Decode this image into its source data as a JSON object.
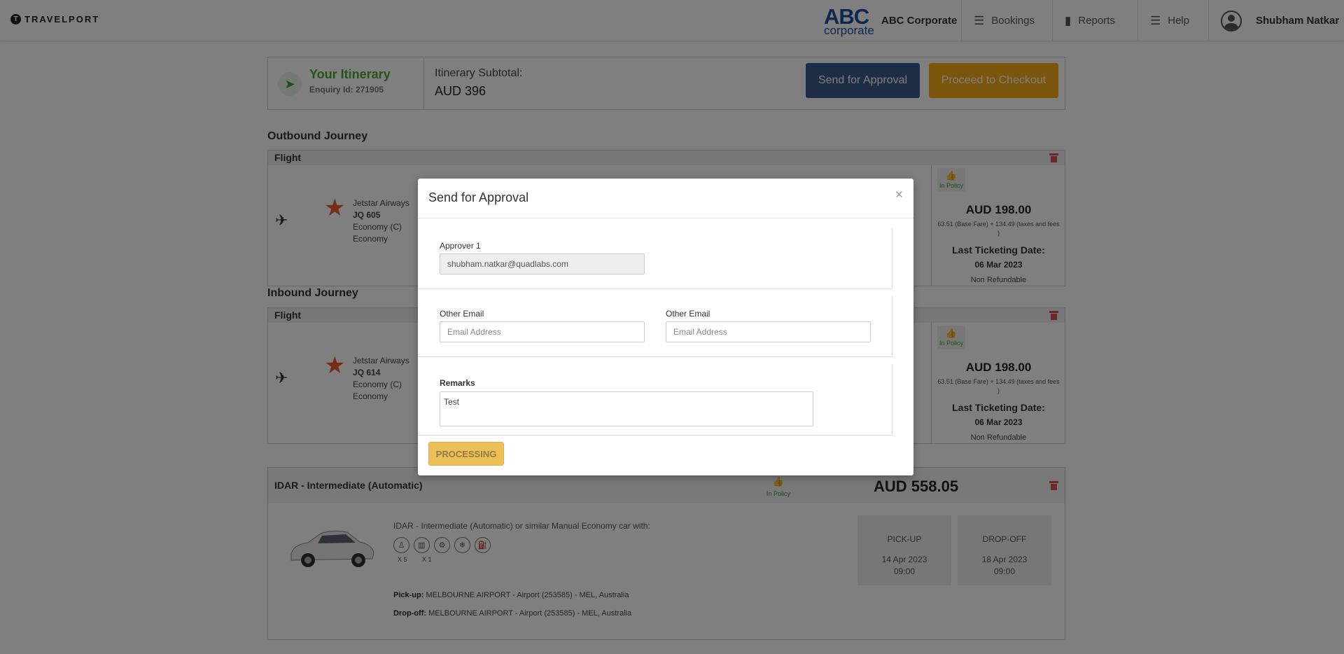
{
  "header": {
    "brand": "TRAVELPORT",
    "corp_logo_main": "ABC",
    "corp_logo_sub": "corporate",
    "company": "ABC Corporate",
    "nav": [
      {
        "label": "Bookings",
        "icon": "list-icon"
      },
      {
        "label": "Reports",
        "icon": "bar-chart-icon"
      },
      {
        "label": "Help",
        "icon": "list-icon"
      }
    ],
    "user_name": "Shubham Natkar"
  },
  "itinerary": {
    "title": "Your Itinerary",
    "enquiry": "Enquiry Id: 271905",
    "subtotal_label": "Itinerary Subtotal:",
    "subtotal_value": "AUD  396",
    "send_approval_label": "Send for Approval",
    "checkout_label": "Proceed to Checkout"
  },
  "outbound": {
    "title": "Outbound Journey",
    "section_label": "Flight",
    "airline": "Jetstar Airways",
    "flight_no": "JQ 605",
    "cabin": "Economy (C)",
    "fare": "Economy",
    "policy": "In Policy",
    "price": "AUD 198.00",
    "breakdown": "63.51 (Base Fare) + 134.49 (taxes and fees )",
    "last_ticketing_label": "Last Ticketing Date:",
    "last_ticketing_date": "06 Mar 2023",
    "refund": "Non Refundable"
  },
  "inbound": {
    "title": "Inbound Journey",
    "section_label": "Flight",
    "airline": "Jetstar Airways",
    "flight_no": "JQ 614",
    "cabin": "Economy (C)",
    "fare": "Economy",
    "policy": "In Policy",
    "price": "AUD 198.00",
    "breakdown": "63.51 (Base Fare) + 134.49 (taxes and fees )",
    "last_ticketing_label": "Last Ticketing Date:",
    "last_ticketing_date": "06 Mar 2023",
    "refund": "Non Refundable"
  },
  "car": {
    "title": "IDAR - Intermediate (Automatic)",
    "policy": "In Policy",
    "price": "AUD 558.05",
    "description": "IDAR - Intermediate (Automatic) or similar Manual Economy car with:",
    "passengers": "X 5",
    "bags": "X 1",
    "pickup_label": "Pick-up:",
    "pickup_location": " MELBOURNE AIRPORT - Airport (253585) - MEL, Australia",
    "dropoff_label": "Drop-off:",
    "dropoff_location": " MELBOURNE AIRPORT - Airport (253585) - MEL, Australia",
    "pickup_box_label": "PICK-UP",
    "pickup_date": "14 Apr 2023",
    "pickup_time": "09:00",
    "dropoff_box_label": "DROP-OFF",
    "dropoff_date": "18 Apr 2023",
    "dropoff_time": "09:00"
  },
  "modal": {
    "title": "Send for Approval",
    "close": "×",
    "approver_label": "Approver 1",
    "approver_value": "shubham.natkar@quadlabs.com",
    "other_email_label_1": "Other Email",
    "other_email_label_2": "Other Email",
    "email_placeholder": "Email Address",
    "remarks_label": "Remarks",
    "remarks_value": "Test",
    "processing_label": "PROCESSING"
  }
}
